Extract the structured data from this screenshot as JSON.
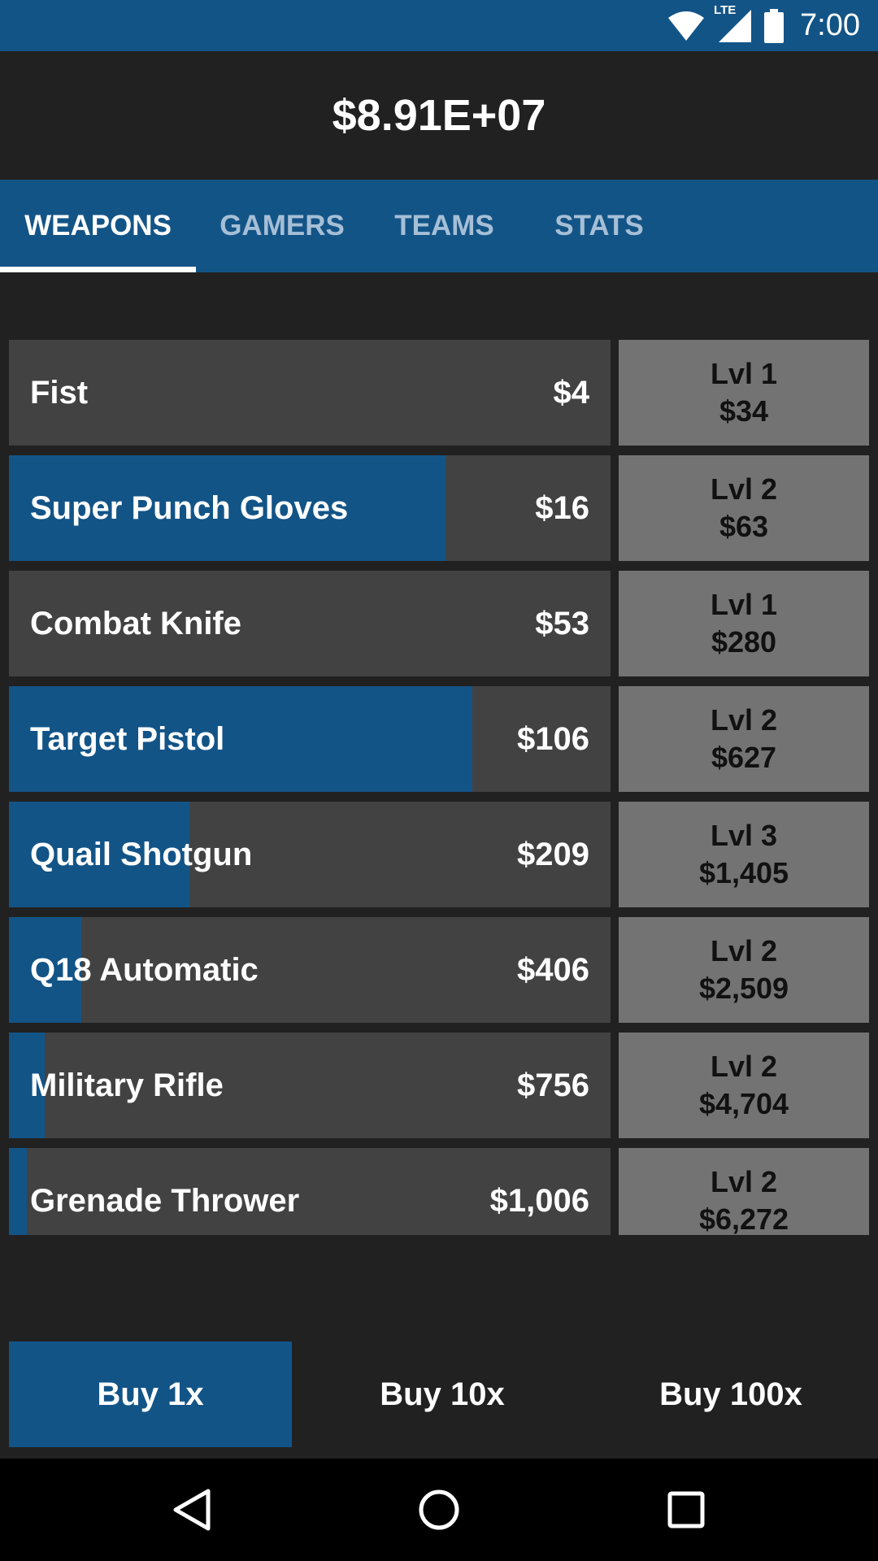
{
  "status_bar": {
    "network": "LTE",
    "time": "7:00",
    "icons": [
      "wifi-icon",
      "cell-signal-icon",
      "battery-icon"
    ]
  },
  "header": {
    "money": "$8.91E+07"
  },
  "tabs": [
    {
      "label": "WEAPONS",
      "active": true
    },
    {
      "label": "GAMERS",
      "active": false
    },
    {
      "label": "TEAMS",
      "active": false
    },
    {
      "label": "STATS",
      "active": false
    }
  ],
  "weapons": [
    {
      "name": "Fist",
      "price": "$4",
      "progress": 0.0,
      "level": "Lvl 1",
      "upgrade_cost": "$34"
    },
    {
      "name": "Super Punch Gloves",
      "price": "$16",
      "progress": 0.725,
      "level": "Lvl 2",
      "upgrade_cost": "$63"
    },
    {
      "name": "Combat Knife",
      "price": "$53",
      "progress": 0.0,
      "level": "Lvl 1",
      "upgrade_cost": "$280"
    },
    {
      "name": "Target Pistol",
      "price": "$106",
      "progress": 0.77,
      "level": "Lvl 2",
      "upgrade_cost": "$627"
    },
    {
      "name": "Quail Shotgun",
      "price": "$209",
      "progress": 0.3,
      "level": "Lvl 3",
      "upgrade_cost": "$1,405"
    },
    {
      "name": "Q18 Automatic",
      "price": "$406",
      "progress": 0.12,
      "level": "Lvl 2",
      "upgrade_cost": "$2,509"
    },
    {
      "name": "Military Rifle",
      "price": "$756",
      "progress": 0.06,
      "level": "Lvl 2",
      "upgrade_cost": "$4,704"
    },
    {
      "name": "Grenade Thrower",
      "price": "$1,006",
      "progress": 0.03,
      "level": "Lvl 2",
      "upgrade_cost": "$6,272"
    }
  ],
  "buy_options": [
    {
      "label": "Buy 1x",
      "selected": true
    },
    {
      "label": "Buy 10x",
      "selected": false
    },
    {
      "label": "Buy 100x",
      "selected": false
    }
  ],
  "nav_bar": [
    "back-icon",
    "home-icon",
    "recents-icon"
  ],
  "colors": {
    "accent": "#135487",
    "background": "#212121",
    "item_bg": "#424242",
    "upgrade_bg": "#737373"
  }
}
